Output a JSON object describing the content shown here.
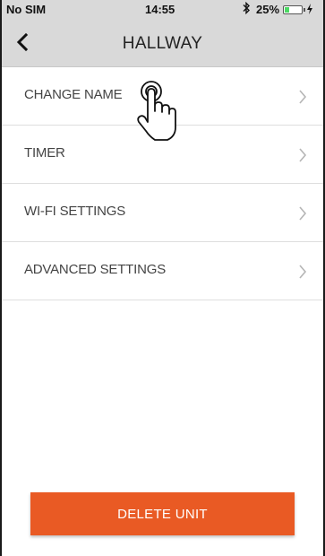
{
  "status_bar": {
    "carrier": "No SIM",
    "time": "14:55",
    "bluetooth_icon": "bluetooth-icon",
    "battery_percent": "25%",
    "battery_level": 0.25,
    "battery_color": "#4cd964"
  },
  "nav": {
    "title": "HALLWAY",
    "back_icon": "chevron-left-icon"
  },
  "menu": {
    "items": [
      {
        "label": "CHANGE NAME"
      },
      {
        "label": "TIMER"
      },
      {
        "label": "WI-FI SETTINGS"
      },
      {
        "label": "ADVANCED SETTINGS"
      }
    ],
    "chevron_icon": "chevron-right-icon"
  },
  "overlay": {
    "icon": "tap-hand-icon"
  },
  "actions": {
    "delete_label": "DELETE UNIT",
    "delete_color": "#e95a24"
  }
}
